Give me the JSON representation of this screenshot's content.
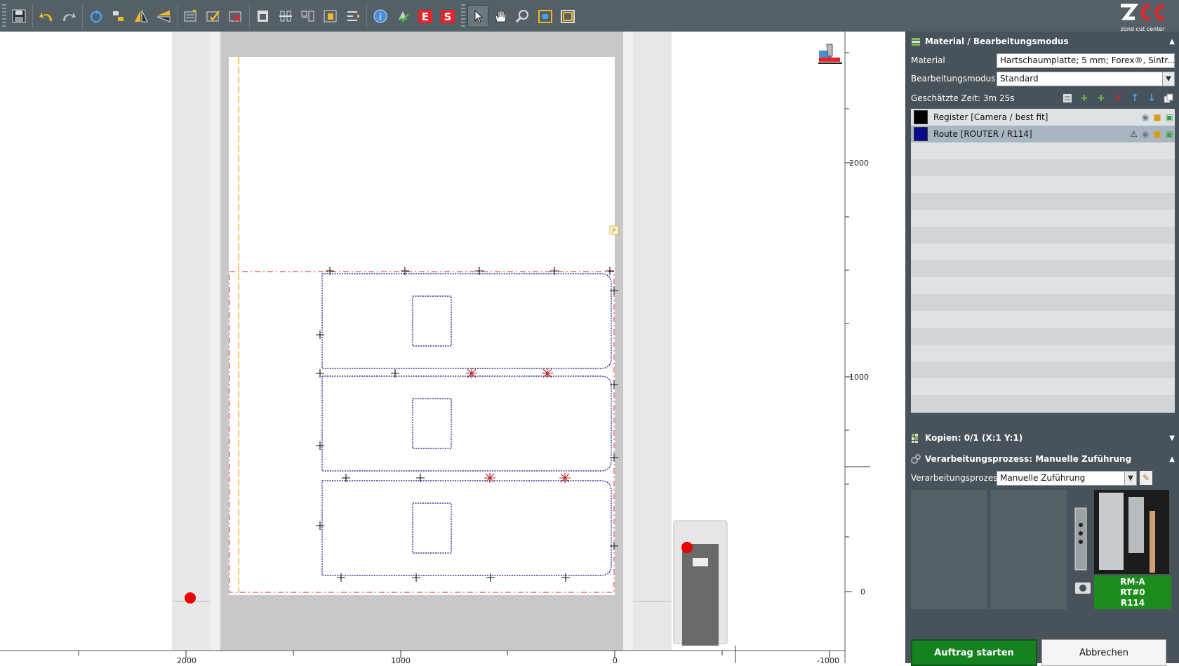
{
  "app": {
    "logo_text": "ZCC",
    "logo_tagline": "zünd cut center"
  },
  "toolbar": {
    "icons": [
      "save-icon",
      "undo-icon",
      "redo-icon",
      "refresh-icon",
      "snap-icon",
      "mirror-vertical-icon",
      "mirror-horizontal-icon",
      "layer-import-icon",
      "layer-check-icon",
      "layer-delete-icon",
      "sheet-icon",
      "distribute-icon",
      "align-icon",
      "register-icon",
      "offset-icon",
      "info-icon",
      "tool-check-icon",
      "export-e-icon",
      "export-s-icon",
      "pointer-icon",
      "hand-icon",
      "zoom-icon",
      "zoom-fit-icon",
      "zoom-page-icon"
    ],
    "active_tool": "pointer-icon"
  },
  "ruler": {
    "x_labels": [
      "2000",
      "1000",
      "0",
      "-1000"
    ],
    "y_labels": [
      "2000",
      "1000",
      "0"
    ]
  },
  "panel": {
    "material_section": {
      "title": "Material / Bearbeitungsmodus",
      "material_label": "Material",
      "material_value": "Hartschaumplatte; 5 mm; Forex®, Sintr...",
      "mode_label": "Bearbeitungsmodus",
      "mode_value": "Standard"
    },
    "estimated_time": "Geschätzte Zeit: 3m 25s",
    "layers": [
      {
        "name": "Register [Camera / best fit]",
        "color": "#000000",
        "warning": false
      },
      {
        "name": "Route [ROUTER / R114]",
        "color": "#0a0a8c",
        "warning": true
      }
    ],
    "copies_title": "Kopien: 0/1 (X:1 Y:1)",
    "process_section": {
      "title": "Verarbeitungsprozess: Manuelle Zuführung",
      "label": "Verarbeitungsprozess",
      "value": "Manuelle Zuführung"
    },
    "tool_label": [
      "RM-A",
      "RT#0",
      "R114"
    ],
    "start_button": "Auftrag starten",
    "cancel_button": "Abbrechen"
  },
  "colors": {
    "toolbar_bg": "#556066",
    "panel_bg": "#48525a",
    "start_green": "#14821e",
    "route_blue": "#0a0a8c",
    "reg_red": "#e3262c"
  }
}
